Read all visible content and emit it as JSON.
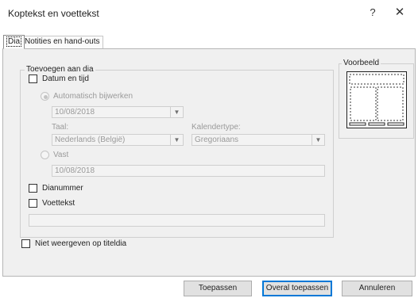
{
  "window": {
    "title": "Koptekst en voettekst",
    "help_glyph": "?",
    "close_glyph": "✕"
  },
  "tabs": [
    {
      "label": "Dia",
      "active": true
    },
    {
      "label": "Notities en hand-outs",
      "active": false
    }
  ],
  "include_group": {
    "legend": "Toevoegen aan dia",
    "date_time": {
      "label": "Datum en tijd",
      "checked": false
    },
    "auto_update": {
      "label": "Automatisch bijwerken",
      "selected": true,
      "date_value": "10/08/2018"
    },
    "language": {
      "label": "Taal:",
      "value": "Nederlands (België)"
    },
    "calendar": {
      "label": "Kalendertype:",
      "value": "Gregoriaans"
    },
    "fixed": {
      "label": "Vast",
      "selected": false,
      "value": "10/08/2018"
    },
    "slide_number": {
      "label": "Dianummer",
      "checked": false
    },
    "footer": {
      "label": "Voettekst",
      "checked": false,
      "value": ""
    }
  },
  "preview": {
    "legend": "Voorbeeld",
    "icon": "slide-layout-preview-icon"
  },
  "dont_show_title": {
    "label": "Niet weergeven op titeldia",
    "checked": false
  },
  "buttons": {
    "apply": "Toepassen",
    "apply_all": "Overal toepassen",
    "cancel": "Annuleren"
  },
  "colors": {
    "accent": "#0078d7"
  }
}
